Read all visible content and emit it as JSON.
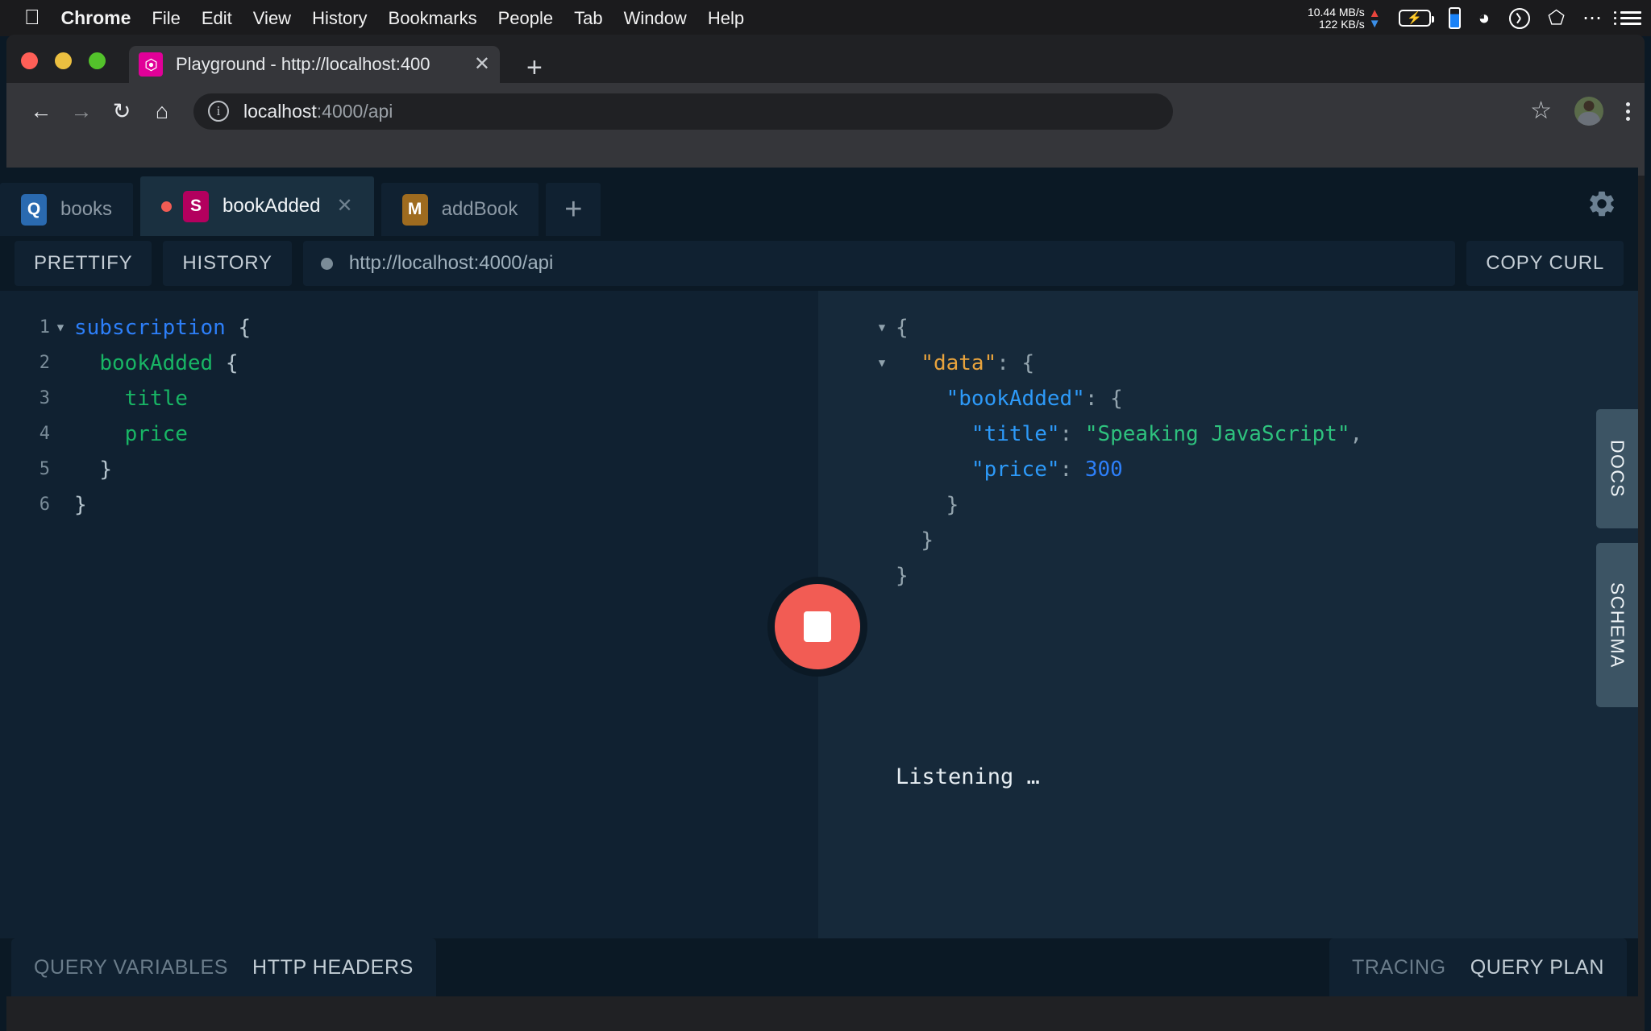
{
  "menubar": {
    "apple_icon": "apple-logo",
    "items": [
      "Chrome",
      "File",
      "Edit",
      "View",
      "History",
      "Bookmarks",
      "People",
      "Tab",
      "Window",
      "Help"
    ],
    "status": {
      "net_down": "10.44 MB/s",
      "net_up": "122 KB/s",
      "icons": [
        "battery-charging-icon",
        "phone-icon",
        "wifi-icon",
        "clock-icon",
        "dropbox-icon",
        "overflow-dots-icon",
        "list-menu-icon"
      ]
    }
  },
  "browser": {
    "tab": {
      "title": "Playground - http://localhost:400",
      "favicon": "graphql-icon",
      "close": "✕"
    },
    "new_tab_label": "+",
    "nav": {
      "back": "←",
      "forward": "→",
      "reload": "↻",
      "home": "⌂"
    },
    "omnibox": {
      "host": "localhost",
      "path": ":4000/api",
      "info_icon": "ℹ"
    },
    "right_icons": {
      "bookmark": "☆",
      "avatar": "profile-avatar",
      "menu": "kebab-menu-icon"
    }
  },
  "playground": {
    "tabs": [
      {
        "badge": "Q",
        "badge_type": "q",
        "label": "books",
        "active": false,
        "has_dot": false,
        "has_close": false
      },
      {
        "badge": "S",
        "badge_type": "s",
        "label": "bookAdded",
        "active": true,
        "has_dot": true,
        "has_close": true,
        "close": "✕"
      },
      {
        "badge": "M",
        "badge_type": "m",
        "label": "addBook",
        "active": false,
        "has_dot": false,
        "has_close": false
      }
    ],
    "add_tab_label": "+",
    "settings_icon": "gear-icon",
    "actions": {
      "prettify": "PRETTIFY",
      "history": "HISTORY",
      "endpoint": "http://localhost:4000/api",
      "copy_curl": "COPY CURL"
    },
    "editor": {
      "lines": [
        {
          "num": "1",
          "fold": "▼",
          "indent": 0,
          "tokens": [
            {
              "t": "subscription",
              "c": "k-kw"
            },
            {
              "t": " {",
              "c": "k-pn"
            }
          ]
        },
        {
          "num": "2",
          "fold": "",
          "indent": 1,
          "tokens": [
            {
              "t": "bookAdded",
              "c": "k-fl"
            },
            {
              "t": " {",
              "c": "k-pn"
            }
          ]
        },
        {
          "num": "3",
          "fold": "",
          "indent": 2,
          "tokens": [
            {
              "t": "title",
              "c": "k-fl"
            }
          ]
        },
        {
          "num": "4",
          "fold": "",
          "indent": 2,
          "tokens": [
            {
              "t": "price",
              "c": "k-fl"
            }
          ]
        },
        {
          "num": "5",
          "fold": "",
          "indent": 1,
          "tokens": [
            {
              "t": "}",
              "c": "k-pn"
            }
          ]
        },
        {
          "num": "6",
          "fold": "",
          "indent": 0,
          "tokens": [
            {
              "t": "}",
              "c": "k-pn"
            }
          ]
        }
      ]
    },
    "result": {
      "lines": [
        {
          "fold": "▼",
          "indent": 0,
          "tokens": [
            {
              "t": "{",
              "c": "rcode"
            }
          ]
        },
        {
          "fold": "▼",
          "indent": 1,
          "tokens": [
            {
              "t": "\"data\"",
              "c": "j-orange"
            },
            {
              "t": ": {",
              "c": "rcode"
            }
          ]
        },
        {
          "fold": "",
          "indent": 2,
          "tokens": [
            {
              "t": "\"bookAdded\"",
              "c": "j-blue"
            },
            {
              "t": ": {",
              "c": "rcode"
            }
          ]
        },
        {
          "fold": "",
          "indent": 3,
          "tokens": [
            {
              "t": "\"title\"",
              "c": "j-blue"
            },
            {
              "t": ": ",
              "c": "rcode"
            },
            {
              "t": "\"Speaking JavaScript\"",
              "c": "j-green"
            },
            {
              "t": ",",
              "c": "rcode"
            }
          ]
        },
        {
          "fold": "",
          "indent": 3,
          "tokens": [
            {
              "t": "\"price\"",
              "c": "j-blue"
            },
            {
              "t": ": ",
              "c": "rcode"
            },
            {
              "t": "300",
              "c": "j-num"
            }
          ]
        },
        {
          "fold": "",
          "indent": 2,
          "tokens": [
            {
              "t": "}",
              "c": "rcode"
            }
          ]
        },
        {
          "fold": "",
          "indent": 1,
          "tokens": [
            {
              "t": "}",
              "c": "rcode"
            }
          ]
        },
        {
          "fold": "",
          "indent": 0,
          "tokens": [
            {
              "t": "}",
              "c": "rcode"
            }
          ]
        }
      ],
      "status_text": "Listening …"
    },
    "stop_button": {
      "name": "stop-subscription-button",
      "color": "#f25c54"
    },
    "side_tabs": {
      "docs": "DOCS",
      "schema": "SCHEMA"
    },
    "footer": {
      "query_variables": "QUERY VARIABLES",
      "http_headers": "HTTP HEADERS",
      "tracing": "TRACING",
      "query_plan": "QUERY PLAN"
    }
  },
  "chart_data": null
}
